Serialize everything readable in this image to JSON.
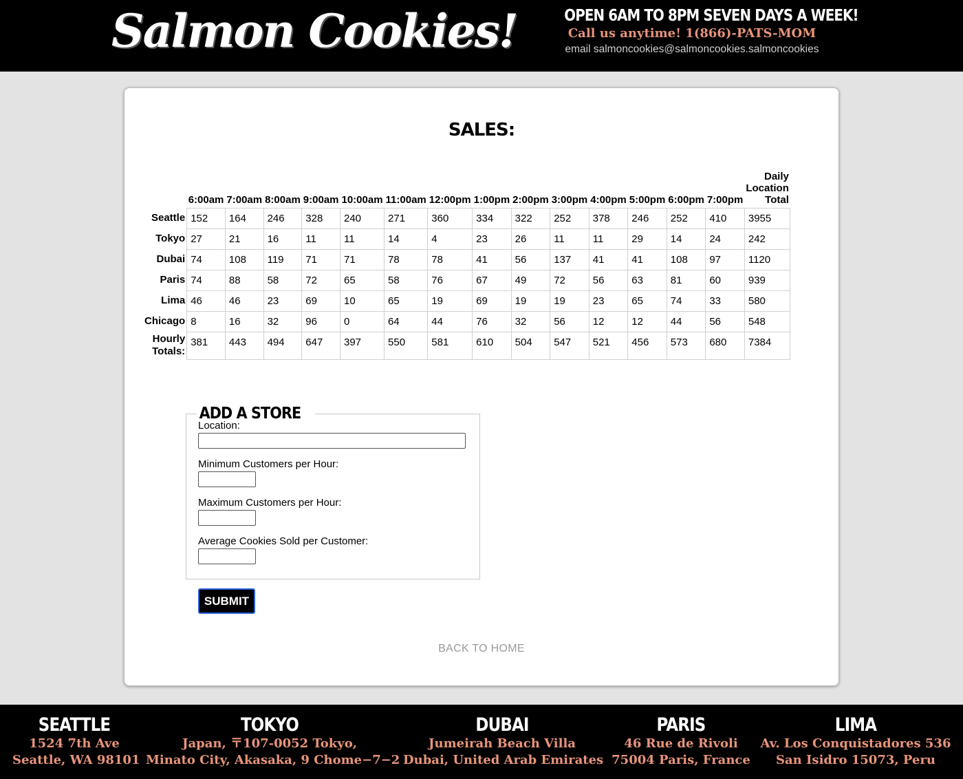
{
  "header": {
    "logo": "Salmon Cookies!",
    "hours": "OPEN 6AM TO 8PM SEVEN DAYS A WEEK!",
    "phone": "Call us anytime! 1(866)-PATS-MOM",
    "email": "email salmoncookies@salmoncookies.salmoncookies"
  },
  "sales": {
    "title": "SALES:",
    "headers": [
      "6:00am",
      "7:00am",
      "8:00am",
      "9:00am",
      "10:00am",
      "11:00am",
      "12:00pm",
      "1:00pm",
      "2:00pm",
      "3:00pm",
      "4:00pm",
      "5:00pm",
      "6:00pm",
      "7:00pm"
    ],
    "total_header": [
      "Daily",
      "Location",
      "Total"
    ],
    "rows": [
      {
        "name": "Seattle",
        "values": [
          152,
          164,
          246,
          328,
          240,
          271,
          360,
          334,
          322,
          252,
          378,
          246,
          252,
          410
        ],
        "total": 3955
      },
      {
        "name": "Tokyo",
        "values": [
          27,
          21,
          16,
          11,
          11,
          14,
          4,
          23,
          26,
          11,
          11,
          29,
          14,
          24
        ],
        "total": 242
      },
      {
        "name": "Dubai",
        "values": [
          74,
          108,
          119,
          71,
          71,
          78,
          78,
          41,
          56,
          137,
          41,
          41,
          108,
          97
        ],
        "total": 1120
      },
      {
        "name": "Paris",
        "values": [
          74,
          88,
          58,
          72,
          65,
          58,
          76,
          67,
          49,
          72,
          56,
          63,
          81,
          60
        ],
        "total": 939
      },
      {
        "name": "Lima",
        "values": [
          46,
          46,
          23,
          69,
          10,
          65,
          19,
          69,
          19,
          19,
          23,
          65,
          74,
          33
        ],
        "total": 580
      },
      {
        "name": "Chicago",
        "values": [
          8,
          16,
          32,
          96,
          0,
          64,
          44,
          76,
          32,
          56,
          12,
          12,
          44,
          56
        ],
        "total": 548
      }
    ],
    "totals_label": [
      "Hourly",
      "Totals:"
    ],
    "totals": [
      381,
      443,
      494,
      647,
      397,
      550,
      581,
      610,
      504,
      547,
      521,
      456,
      573,
      680
    ],
    "grand_total": 7384
  },
  "form": {
    "legend": "ADD A STORE",
    "location_label": "Location:",
    "location_value": "",
    "min_label": "Minimum Customers per Hour:",
    "min_value": "",
    "max_label": "Maximum Customers per Hour:",
    "max_value": "",
    "avg_label": "Average Cookies Sold per Customer:",
    "avg_value": "",
    "submit_label": "SUBMIT"
  },
  "back_link": "BACK TO HOME",
  "footer": {
    "locations": [
      {
        "city": "SEATTLE",
        "line1": "1524 7th Ave",
        "line2": "Seattle, WA 98101"
      },
      {
        "city": "TOKYO",
        "line1": "Japan, 〒107-0052 Tokyo,",
        "line2": "Minato City, Akasaka, 9 Chome−7−2"
      },
      {
        "city": "DUBAI",
        "line1": "Jumeirah Beach Villa",
        "line2": "Dubai, United Arab Emirates"
      },
      {
        "city": "PARIS",
        "line1": "46 Rue de Rivoli",
        "line2": "75004 Paris, France"
      },
      {
        "city": "LIMA",
        "line1": "Av. Los Conquistadores 536",
        "line2": "San Isidro 15073, Peru"
      }
    ]
  },
  "colors": {
    "accent": "#e8947a",
    "header_bg": "#000000",
    "page_bg": "#e3e3e3",
    "link": "#9a9a9a"
  }
}
